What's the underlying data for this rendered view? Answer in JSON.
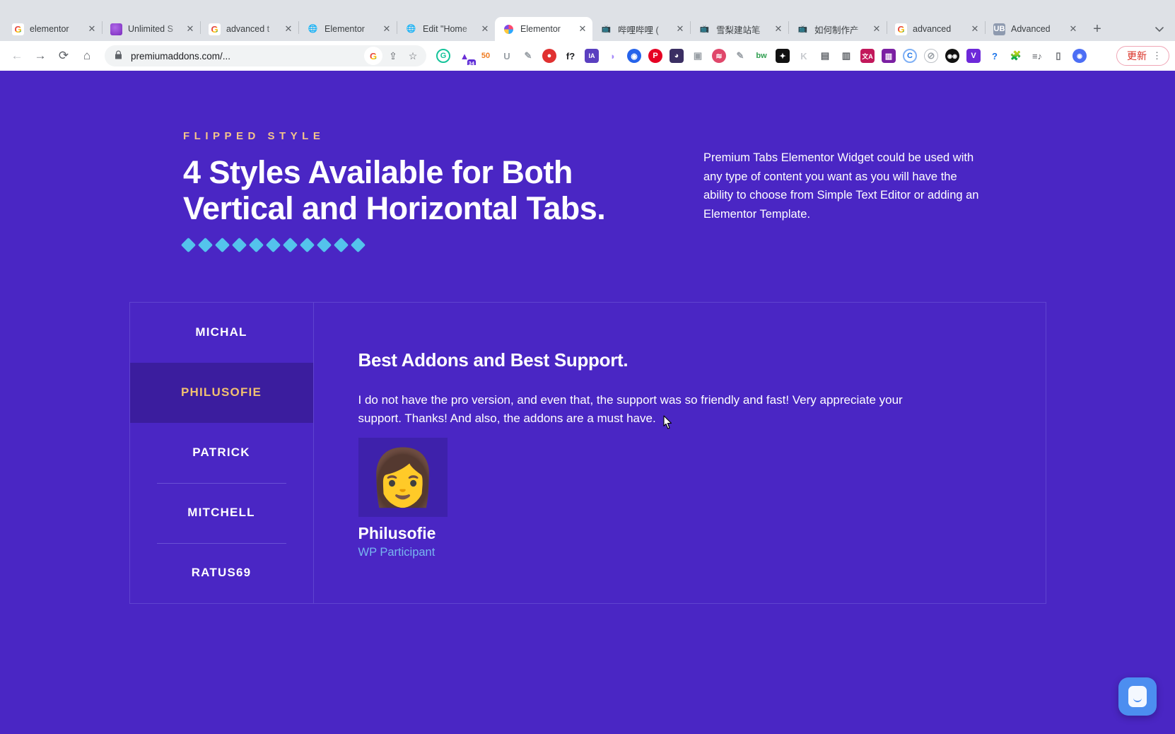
{
  "browser": {
    "tabs": [
      {
        "title": "elementor",
        "favicon": "google-icon",
        "active": false
      },
      {
        "title": "Unlimited S",
        "favicon": "purple-ball-icon",
        "active": false
      },
      {
        "title": "advanced t",
        "favicon": "google-icon",
        "active": false
      },
      {
        "title": "Elementor",
        "favicon": "globe-icon",
        "active": false
      },
      {
        "title": "Edit \"Home",
        "favicon": "globe-icon",
        "active": false
      },
      {
        "title": "Elementor",
        "favicon": "elementor-icon",
        "active": true
      },
      {
        "title": "哔哩哔哩 (",
        "favicon": "bilibili-icon",
        "active": false
      },
      {
        "title": "雪梨建站笔",
        "favicon": "bilibili-icon",
        "active": false
      },
      {
        "title": "如何制作产",
        "favicon": "bilibili-icon",
        "active": false
      },
      {
        "title": "advanced",
        "favicon": "google-icon",
        "active": false
      },
      {
        "title": "Advanced",
        "favicon": "ub-icon",
        "active": false
      }
    ],
    "new_tab_label": "+",
    "tab_search_label": "⌄",
    "nav": {
      "back": "←",
      "forward": "→",
      "reload": "⟳",
      "home": "⌂"
    },
    "omnibox": {
      "lock": "🔒",
      "url": "premiumaddons.com/...",
      "google_lens": "G",
      "share": "⇪",
      "bookmark": "☆"
    },
    "extensions": [
      {
        "name": "grammarly-icon",
        "glyph": "G",
        "color": "#15c39a",
        "shape": "circle-outline"
      },
      {
        "name": "purple-arrow-icon",
        "glyph": "▲",
        "color": "#6b2fd6",
        "badge": "34"
      },
      {
        "name": "seo-quake-icon",
        "glyph": "50",
        "color": "#f5a623"
      },
      {
        "name": "unity-u-icon",
        "glyph": "U",
        "color": "#9aa0a6"
      },
      {
        "name": "note-icon",
        "glyph": "✎",
        "color": "#9aa0a6"
      },
      {
        "name": "pokeball-icon",
        "glyph": "●",
        "color": "#e03131"
      },
      {
        "name": "font-finder-icon",
        "glyph": "f?",
        "color": "#202124"
      },
      {
        "name": "internet-archive-icon",
        "glyph": "IA",
        "color": "#5a3fc0"
      },
      {
        "name": "gradient-leaf-icon",
        "glyph": "◗",
        "color": "#a78bfa"
      },
      {
        "name": "loom-icon",
        "glyph": "◉",
        "color": "#2563eb"
      },
      {
        "name": "pinterest-icon",
        "glyph": "P",
        "color": "#e60023"
      },
      {
        "name": "discord-icon",
        "glyph": "◕",
        "color": "#3b2f63"
      },
      {
        "name": "camera-icon",
        "glyph": "▣",
        "color": "#9aa0a6"
      },
      {
        "name": "similarweb-icon",
        "glyph": "≋",
        "color": "#e0476b"
      },
      {
        "name": "eyedropper-icon",
        "glyph": "✎",
        "color": "#9aa0a6"
      },
      {
        "name": "bw-icon",
        "glyph": "bw",
        "color": "#2e9e4f"
      },
      {
        "name": "ninja-icon",
        "glyph": "✦",
        "color": "#111111"
      },
      {
        "name": "keywords-k-icon",
        "glyph": "K",
        "color": "#c8cbcf"
      },
      {
        "name": "copy-pages-icon",
        "glyph": "▤",
        "color": "#5f6368"
      },
      {
        "name": "bank-icon",
        "glyph": "▥",
        "color": "#5f6368"
      },
      {
        "name": "translate-icon",
        "glyph": "文A",
        "color": "#c2185b"
      },
      {
        "name": "chart-icon",
        "glyph": "▥",
        "color": "#7b1fa2"
      },
      {
        "name": "copyright-c-icon",
        "glyph": "C",
        "color": "#1a73e8"
      },
      {
        "name": "slash-circle-icon",
        "glyph": "⊘",
        "color": "#9aa0a6"
      },
      {
        "name": "eyes-icon",
        "glyph": "◉◉",
        "color": "#111111"
      },
      {
        "name": "vue-v-icon",
        "glyph": "V",
        "color": "#6d28d9"
      },
      {
        "name": "help-icon",
        "glyph": "?",
        "color": "#1a73e8"
      },
      {
        "name": "extensions-puzzle-icon",
        "glyph": "🧩",
        "color": "#5f6368"
      },
      {
        "name": "playlist-icon",
        "glyph": "≡♪",
        "color": "#5f6368"
      },
      {
        "name": "side-panel-icon",
        "glyph": "▯",
        "color": "#5f6368"
      },
      {
        "name": "profile-avatar",
        "glyph": "◉",
        "color": "#4c6ef5"
      }
    ],
    "update_button": {
      "label": "更新",
      "kebab": "⋮"
    }
  },
  "page": {
    "hero": {
      "eyebrow": "FLIPPED STYLE",
      "title": "4 Styles Available for Both Vertical and Horizontal Tabs.",
      "description": "Premium Tabs Elementor Widget could be used with any type of content you want as you will have the ability to choose from Simple Text Editor or adding an Elementor Template.",
      "diamond_count": 11,
      "diamond_color": "#54c3ec",
      "eyebrow_color": "#f4c48a"
    },
    "tabs_widget": {
      "nav_items": [
        {
          "label": "MICHAL",
          "active": false,
          "separator_above": false
        },
        {
          "label": "PHILUSOFIE",
          "active": true,
          "separator_above": false
        },
        {
          "label": "PATRICK",
          "active": false,
          "separator_above": false
        },
        {
          "label": "MITCHELL",
          "active": false,
          "separator_above": true
        },
        {
          "label": "RATUS69",
          "active": false,
          "separator_above": true
        }
      ],
      "active_tab_bg": "#3b1d9e",
      "active_tab_color": "#f0c070",
      "content": {
        "title": "Best Addons and Best Support.",
        "body": "I do not have the pro version, and even that, the support was so friendly and fast! Very appreciate your support. Thanks! And also, the addons are a must have.",
        "avatar_emoji": "👩",
        "author_name": "Philusofie",
        "author_role": "WP Participant",
        "author_role_color": "#78b6ef"
      }
    },
    "background_color": "#4a26c4",
    "chat_widget_name": "chat-launcher"
  }
}
